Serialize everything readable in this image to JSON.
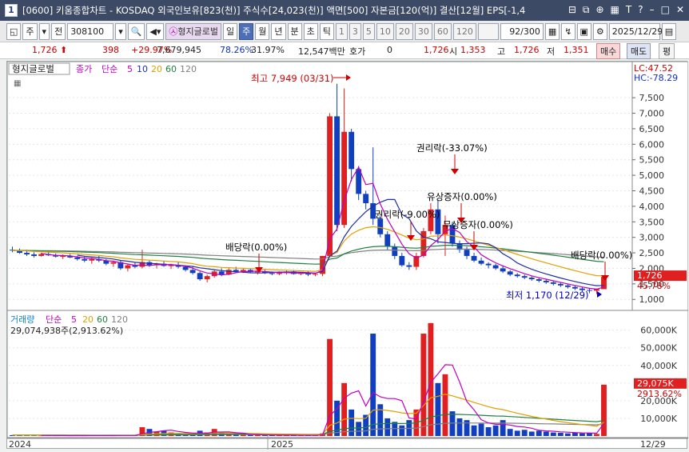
{
  "window": {
    "number": "1",
    "title": "[0600] 키움종합차트 - KOSDAQ 외국인보유[823(천)] 주식수[24,023(천)] 액면[500] 자본금[120(억)] 결산[12월] EPS[-1,4",
    "tool_icons": [
      "dock-icon",
      "copy-icon",
      "link-icon",
      "tile-icon",
      "text-icon",
      "help-icon",
      "minimize-icon",
      "maximize-icon",
      "close-icon"
    ]
  },
  "toolbar": {
    "mode": "주",
    "jeon": "전",
    "code": "308100",
    "name": "형지글로벌",
    "periods": [
      "일",
      "주",
      "월",
      "년",
      "분",
      "초",
      "틱"
    ],
    "selected_period": "주",
    "intervals": [
      "1",
      "3",
      "5",
      "10",
      "20",
      "30",
      "60",
      "120"
    ],
    "count": "92/300",
    "date": "2025/12/29"
  },
  "infobar": {
    "price": "1,726",
    "change": "398",
    "change_pct": "+29.97%",
    "volume": "7,679,945",
    "vol_pct": "78.26%",
    "turnover": "31.97%",
    "amount": "12,547백만",
    "hoga_label": "호가",
    "hoga_value": "0",
    "hoga_price": "1,726",
    "open_label": "시",
    "open": "1,353",
    "high_label": "고",
    "high": "1,726",
    "low_label": "저",
    "low": "1,351",
    "buy": "매수",
    "sell": "매도",
    "even": "평"
  },
  "chart_data": [
    {
      "type": "candlestick",
      "title": "형지글로벌",
      "legend": [
        {
          "label": "종가",
          "color": "#c000c0"
        },
        {
          "label": "단순",
          "color": "#c000c0"
        },
        {
          "label": "5",
          "color": "#c000c0"
        },
        {
          "label": "10",
          "color": "#2030a0"
        },
        {
          "label": "20",
          "color": "#e0a000"
        },
        {
          "label": "60",
          "color": "#208040"
        },
        {
          "label": "120",
          "color": "#808080"
        }
      ],
      "yticks": [
        "7,500",
        "7,000",
        "6,500",
        "6,000",
        "5,500",
        "5,000",
        "4,500",
        "4,000",
        "3,500",
        "3,000",
        "2,500",
        "2,000",
        "1,500",
        "1,000"
      ],
      "ylim": [
        800,
        8200
      ],
      "lc": "LC:47.52",
      "hc": "HC:-78.29",
      "current_price": "1,726",
      "current_pct": "45.78%",
      "annotations": [
        {
          "text": "최고 7,949 (03/31)",
          "color": "#d00000"
        },
        {
          "text": "권리락(-33.07%)",
          "color": "#000000"
        },
        {
          "text": "유상증자(0.00%)",
          "color": "#000000"
        },
        {
          "text": "권리락(-9.00%)",
          "color": "#000000"
        },
        {
          "text": "무상증자(0.00%)",
          "color": "#000000"
        },
        {
          "text": "배당락(0.00%)",
          "color": "#000000"
        },
        {
          "text": "배당락(0.00%)",
          "color": "#000000"
        },
        {
          "text": "최저 1,170 (12/29)",
          "color": "#0000c0"
        }
      ],
      "ohlc": [
        [
          2600,
          2700,
          2520,
          2580
        ],
        [
          2580,
          2640,
          2470,
          2500
        ],
        [
          2500,
          2600,
          2400,
          2450
        ],
        [
          2450,
          2520,
          2350,
          2400
        ],
        [
          2400,
          2500,
          2380,
          2460
        ],
        [
          2460,
          2530,
          2400,
          2420
        ],
        [
          2420,
          2480,
          2350,
          2380
        ],
        [
          2380,
          2450,
          2300,
          2400
        ],
        [
          2400,
          2460,
          2330,
          2350
        ],
        [
          2350,
          2400,
          2250,
          2300
        ],
        [
          2300,
          2380,
          2200,
          2250
        ],
        [
          2250,
          2350,
          2150,
          2300
        ],
        [
          2300,
          2400,
          2200,
          2250
        ],
        [
          2250,
          2300,
          2100,
          2150
        ],
        [
          2150,
          2250,
          2050,
          2200
        ],
        [
          2200,
          2260,
          1950,
          2000
        ],
        [
          2000,
          2150,
          1900,
          2100
        ],
        [
          2100,
          2200,
          2000,
          2050
        ],
        [
          2050,
          2600,
          2000,
          2200
        ],
        [
          2200,
          2250,
          2050,
          2100
        ],
        [
          2100,
          2180,
          2000,
          2150
        ],
        [
          2150,
          2250,
          2050,
          2080
        ],
        [
          2080,
          2150,
          1980,
          2100
        ],
        [
          2100,
          2200,
          2000,
          2050
        ],
        [
          2050,
          2100,
          1900,
          1950
        ],
        [
          1950,
          2050,
          1800,
          1850
        ],
        [
          1850,
          1900,
          1600,
          1650
        ],
        [
          1650,
          1800,
          1550,
          1750
        ],
        [
          1750,
          1950,
          1700,
          1900
        ],
        [
          1900,
          2000,
          1750,
          1800
        ],
        [
          1800,
          2000,
          1780,
          1950
        ],
        [
          1950,
          2050,
          1850,
          1900
        ],
        [
          1900,
          2000,
          1850,
          1950
        ],
        [
          1950,
          2000,
          1850,
          1880
        ],
        [
          1880,
          1950,
          1800,
          1900
        ],
        [
          1900,
          1950,
          1820,
          1850
        ],
        [
          1850,
          1900,
          1780,
          1820
        ],
        [
          1820,
          1900,
          1780,
          1850
        ],
        [
          1850,
          1950,
          1800,
          1900
        ],
        [
          1900,
          1950,
          1800,
          1820
        ],
        [
          1820,
          1880,
          1780,
          1850
        ],
        [
          1850,
          1900,
          1750,
          1800
        ],
        [
          1800,
          1850,
          1750,
          1820
        ],
        [
          1820,
          2000,
          1750,
          2400
        ],
        [
          2400,
          7000,
          2350,
          6900
        ],
        [
          6900,
          7949,
          3200,
          3400
        ],
        [
          3400,
          7800,
          3300,
          6400
        ],
        [
          6400,
          6500,
          4800,
          5200
        ],
        [
          5200,
          5300,
          4200,
          4400
        ],
        [
          4400,
          4500,
          3900,
          4100
        ],
        [
          4100,
          5900,
          3400,
          3600
        ],
        [
          3600,
          3700,
          3000,
          3100
        ],
        [
          3100,
          3200,
          2600,
          2700
        ],
        [
          2700,
          2800,
          2300,
          2400
        ],
        [
          2400,
          2500,
          2050,
          2100
        ],
        [
          2100,
          2200,
          1950,
          2050
        ],
        [
          2050,
          2500,
          1950,
          2400
        ],
        [
          2400,
          3300,
          2350,
          3200
        ],
        [
          3200,
          4100,
          3100,
          3900
        ],
        [
          3900,
          4200,
          2800,
          3100
        ],
        [
          3100,
          3700,
          2400,
          3400
        ],
        [
          3400,
          3500,
          2700,
          2800
        ],
        [
          2800,
          2900,
          2500,
          2600
        ],
        [
          2600,
          2700,
          2300,
          2400
        ],
        [
          2400,
          2500,
          2200,
          2250
        ],
        [
          2250,
          2350,
          2100,
          2150
        ],
        [
          2150,
          2200,
          2000,
          2100
        ],
        [
          2100,
          2150,
          1950,
          2000
        ],
        [
          2000,
          2100,
          1850,
          1900
        ],
        [
          1900,
          1950,
          1750,
          1800
        ],
        [
          1800,
          1850,
          1700,
          1750
        ],
        [
          1750,
          1800,
          1650,
          1700
        ],
        [
          1700,
          1750,
          1600,
          1650
        ],
        [
          1650,
          1700,
          1550,
          1600
        ],
        [
          1600,
          1650,
          1500,
          1550
        ],
        [
          1550,
          1600,
          1450,
          1500
        ],
        [
          1500,
          1550,
          1400,
          1450
        ],
        [
          1450,
          1500,
          1350,
          1400
        ],
        [
          1400,
          1450,
          1300,
          1350
        ],
        [
          1350,
          1400,
          1250,
          1300
        ],
        [
          1300,
          1350,
          1200,
          1280
        ],
        [
          1280,
          1350,
          1170,
          1330
        ],
        [
          1330,
          1726,
          1351,
          1726
        ]
      ],
      "colors": {
        "up": "#e02020",
        "down": "#1040c0"
      }
    },
    {
      "type": "bar",
      "title": "거래량",
      "legend": [
        {
          "label": "거래량",
          "color": "#1080c0"
        },
        {
          "label": "단순",
          "color": "#c000c0"
        },
        {
          "label": "5",
          "color": "#c000c0"
        },
        {
          "label": "20",
          "color": "#e0a000"
        },
        {
          "label": "60",
          "color": "#208040"
        },
        {
          "label": "120",
          "color": "#808080"
        }
      ],
      "summary": "29,074,938주(2,913.62%)",
      "yticks": [
        "60,000K",
        "50,000K",
        "40,000K",
        "30,000K",
        "20,000K",
        "10,000K"
      ],
      "ylim": [
        0,
        68000
      ],
      "current_value": "29,075K",
      "current_pct": "2913.62%",
      "values": [
        500,
        300,
        400,
        300,
        200,
        300,
        200,
        300,
        200,
        300,
        200,
        300,
        400,
        300,
        200,
        500,
        300,
        400,
        5000,
        4000,
        2500,
        3000,
        2000,
        1500,
        1200,
        800,
        3000,
        2000,
        4000,
        1500,
        1000,
        800,
        700,
        600,
        500,
        400,
        500,
        400,
        500,
        400,
        300,
        400,
        300,
        1500,
        55000,
        20000,
        30000,
        15000,
        8000,
        12000,
        58000,
        18000,
        10000,
        8000,
        6000,
        9000,
        15000,
        58000,
        64000,
        30000,
        35000,
        14000,
        10000,
        9000,
        6000,
        7000,
        5000,
        6000,
        9000,
        4000,
        3000,
        3500,
        2500,
        3000,
        2500,
        2000,
        1800,
        1500,
        2000,
        1500,
        1800,
        1200,
        29075
      ]
    }
  ],
  "x_labels": [
    "2024",
    "2025",
    "12/29"
  ]
}
